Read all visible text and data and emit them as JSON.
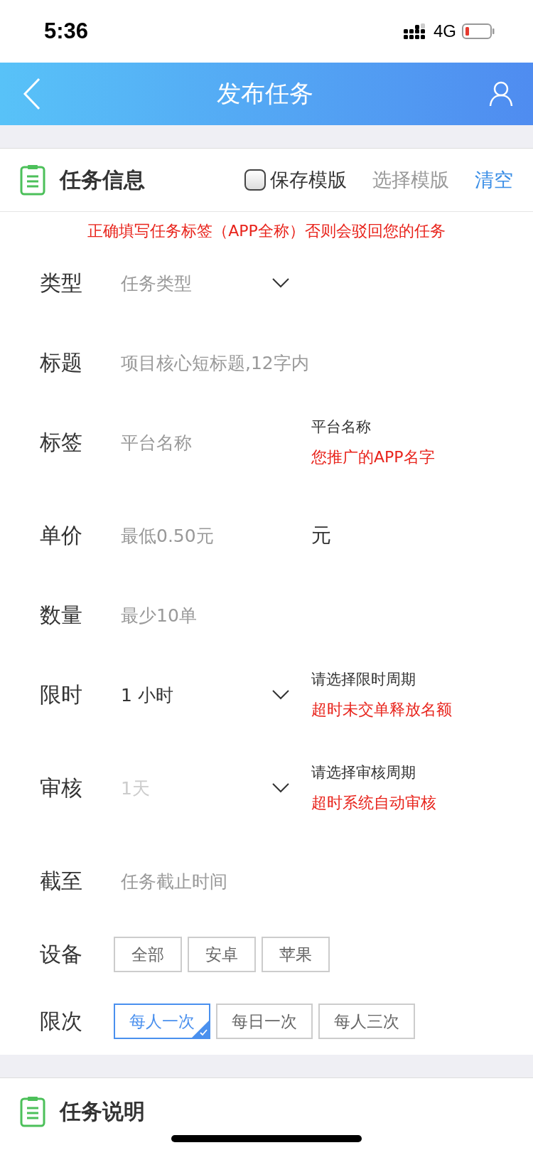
{
  "status_bar": {
    "time": "5:36",
    "network": "4G"
  },
  "header": {
    "title": "发布任务"
  },
  "task_info": {
    "title": "任务信息",
    "save_template": {
      "label": "保存模版",
      "checked": false
    },
    "choose_template": "选择模版",
    "clear": "清空",
    "warning": "正确填写任务标签（APP全称）否则会驳回您的任务",
    "fields": [
      {
        "kind": "select",
        "label": "类型",
        "placeholder": "任务类型"
      },
      {
        "kind": "input",
        "label": "标题",
        "placeholder": "项目核心短标题,12字内"
      },
      {
        "kind": "input",
        "label": "标签",
        "placeholder": "平台名称",
        "hint": "平台名称",
        "note": "您推广的APP名字"
      },
      {
        "kind": "input",
        "label": "单价",
        "placeholder": "最低0.50元",
        "unit": "元"
      },
      {
        "kind": "input",
        "label": "数量",
        "placeholder": "最少10单"
      },
      {
        "kind": "select",
        "label": "限时",
        "value": "1 小时",
        "hint": "请选择限时周期",
        "note": "超时未交单释放名额"
      },
      {
        "kind": "select",
        "label": "审核",
        "placeholder": "1天",
        "hint": "请选择审核周期",
        "note": "超时系统自动审核"
      },
      {
        "kind": "input",
        "label": "截至",
        "placeholder": "任务截止时间"
      },
      {
        "kind": "options",
        "label": "设备",
        "options": [
          {
            "label": "全部",
            "selected": false
          },
          {
            "label": "安卓",
            "selected": false
          },
          {
            "label": "苹果",
            "selected": false
          }
        ]
      },
      {
        "kind": "options",
        "label": "限次",
        "options": [
          {
            "label": "每人一次",
            "selected": true
          },
          {
            "label": "每日一次",
            "selected": false
          },
          {
            "label": "每人三次",
            "selected": false
          }
        ]
      }
    ]
  },
  "task_desc": {
    "title": "任务说明"
  }
}
